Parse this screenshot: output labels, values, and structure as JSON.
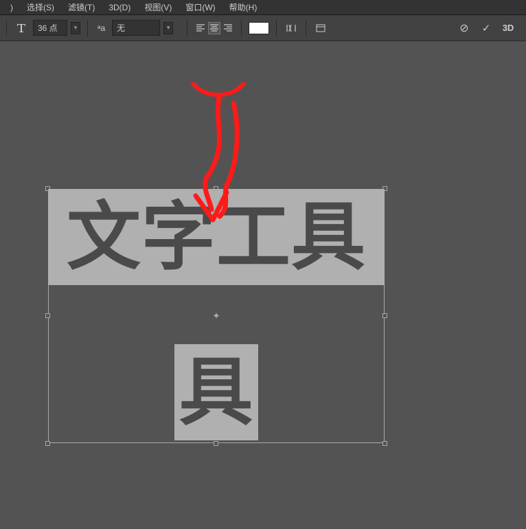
{
  "menubar": {
    "items": [
      {
        "label": ")"
      },
      {
        "label": "选择(S)"
      },
      {
        "label": "滤镜(T)"
      },
      {
        "label": "3D(D)"
      },
      {
        "label": "视图(V)"
      },
      {
        "label": "窗口(W)"
      },
      {
        "label": "帮助(H)"
      }
    ]
  },
  "toolbar": {
    "font_size": "36 点",
    "antialias_label": "ᵃa",
    "tracking": "无",
    "text_tool_glyph": "T"
  },
  "canvas": {
    "text_line1": "文字工具",
    "text_line2": "具"
  },
  "icons": {
    "cancel": "⊘",
    "confirm": "✓",
    "threed": "3D",
    "warp": "⟠",
    "panel": "▭"
  }
}
